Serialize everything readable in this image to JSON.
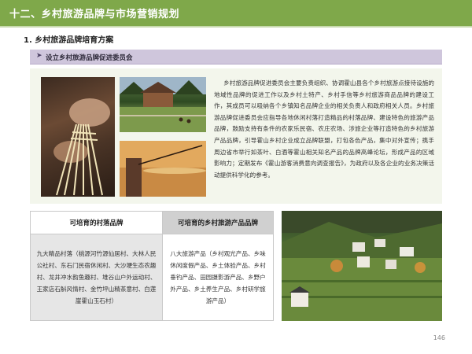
{
  "header": {
    "title": "十二、乡村旅游品牌与市场营销规划"
  },
  "section": {
    "heading": "1. 乡村旅游品牌培育方案"
  },
  "subsection": {
    "title": "设立乡村旅游品牌促进委员会"
  },
  "body": {
    "paragraph": "乡村旅游品牌促进委员会主要负责组织、协调霍山县各个乡村旅游点接待设施的地域性品牌的促进工作以及乡村土特产、乡村手信等乡村旅游商品品牌的建设工作，其成员可以吸纳各个乡镇知名品牌企业的相关负责人和政府相关人员。乡村旅游品牌促进委员会应指导各地休闲村落打造精品的村落品牌、建设特色的旅游产品品牌，鼓励支持有条件的农家乐民宿、农庄农场、涉旅企业等打造特色的乡村旅游产品品牌，引导霍山乡村企业成立品牌联盟，打包各色产品，集中对外宣传；携手周边省市举行如茶叶、白酒等霍山相关知名产品的品牌高峰论坛，形成产品的区域影响力；定期发布《霍山游客消费意向调查报告》，为政府以及各企业的业务决策活动提供科学化的参考。"
  },
  "table": {
    "col1_header": "可培育的村落品牌",
    "col2_header": "可培育的乡村旅游产品品牌",
    "col1_body": "九大精品村落（桃源河竹源仙居村、大林人民公社村、东石门民宿休闲村、大沙埂生态农趣村、龙井冲水韵鱼趣村、堆谷山户外运动村、王家店石斛风情村、金竹坪山精茶意村、白莲崖霍山玉石村）",
    "col2_body": "八大旅游产品（乡村观光产品、乡味休闲度假产品、乡土体验产品、乡村垂钓产品、田园摄影游产品、乡野户外产品、乡土养生产品、乡村研学旅游产品）"
  },
  "footer": {
    "page_number": "146"
  },
  "colors": {
    "title_bar": "#7fa84a",
    "sub_bar": "#cfc6dc",
    "panel": "#f3f6ec",
    "table_header_gray": "#d0d0d0"
  },
  "icons": {
    "sub_bullet": "chevron-right-icon"
  }
}
